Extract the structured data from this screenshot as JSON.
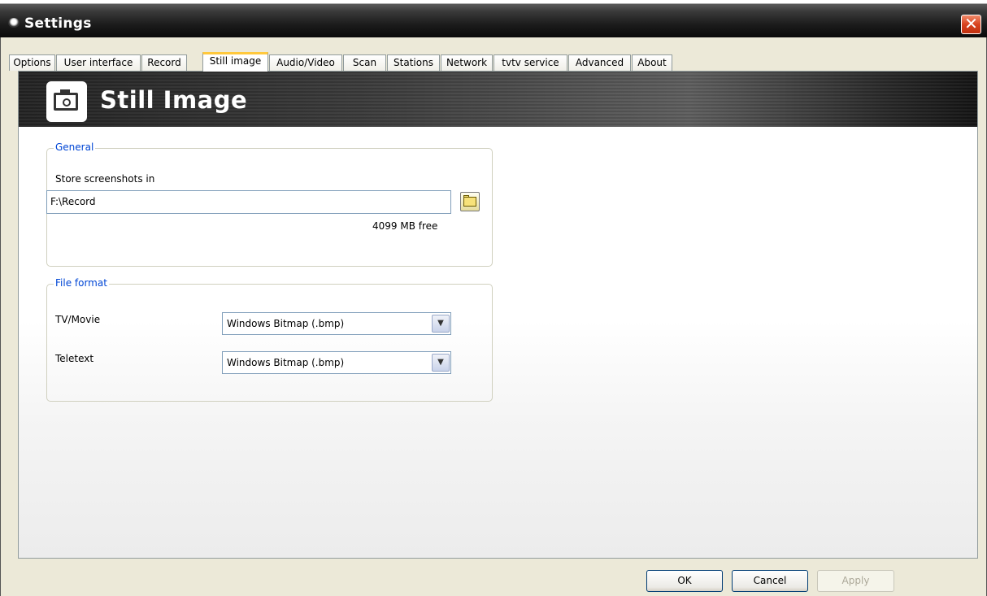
{
  "window": {
    "title": "Settings",
    "close_label": "✕"
  },
  "tabs": [
    {
      "label": "Options",
      "active": false
    },
    {
      "label": "User interface",
      "active": false
    },
    {
      "label": "Record",
      "active": false
    },
    {
      "label": "Still image",
      "active": true
    },
    {
      "label": "Audio/Video",
      "active": false
    },
    {
      "label": "Scan",
      "active": false
    },
    {
      "label": "Stations",
      "active": false
    },
    {
      "label": "Network",
      "active": false
    },
    {
      "label": "tvtv service",
      "active": false
    },
    {
      "label": "Advanced",
      "active": false
    },
    {
      "label": "About",
      "active": false
    }
  ],
  "banner": {
    "title": "Still Image",
    "icon": "camera-icon"
  },
  "general": {
    "group_title": "General",
    "store_label": "Store screenshots in",
    "path_value": "F:\\Record",
    "free_space": "4099 MB free"
  },
  "file_format": {
    "group_title": "File format",
    "tv_label": "TV/Movie",
    "tv_value": "Windows Bitmap (.bmp)",
    "teletext_label": "Teletext",
    "teletext_value": "Windows Bitmap (.bmp)"
  },
  "buttons": {
    "ok": "OK",
    "cancel": "Cancel",
    "apply": "Apply"
  },
  "colors": {
    "accent": "#0046d5",
    "close": "#d8431f",
    "active_tab": "#ffc83c"
  }
}
